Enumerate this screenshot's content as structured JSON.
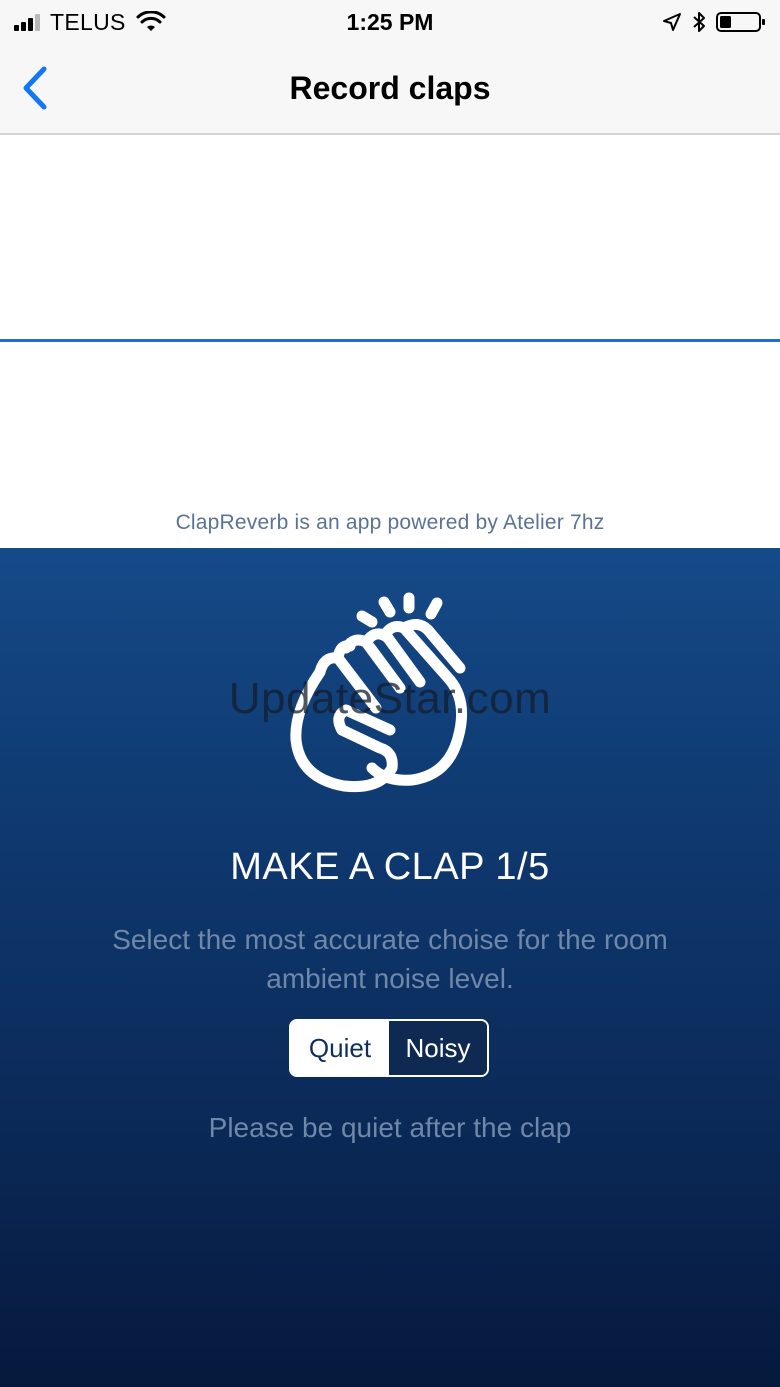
{
  "status_bar": {
    "carrier": "TELUS",
    "time": "1:25 PM"
  },
  "nav": {
    "title": "Record claps"
  },
  "waveform": {
    "powered_by": "ClapReverb is an app powered by Atelier 7hz",
    "line_color": "#1d6fd6"
  },
  "clap_panel": {
    "watermark": "UpdateStar.com",
    "title": "MAKE A CLAP 1/5",
    "instruction": "Select the most accurate choise for the room ambient noise level.",
    "options": [
      {
        "label": "Quiet",
        "selected": true
      },
      {
        "label": "Noisy",
        "selected": false
      }
    ],
    "note": "Please be quiet after the clap"
  },
  "colors": {
    "accent": "#1d6fd6",
    "panel_top": "#154a88",
    "panel_bottom": "#06193d"
  }
}
